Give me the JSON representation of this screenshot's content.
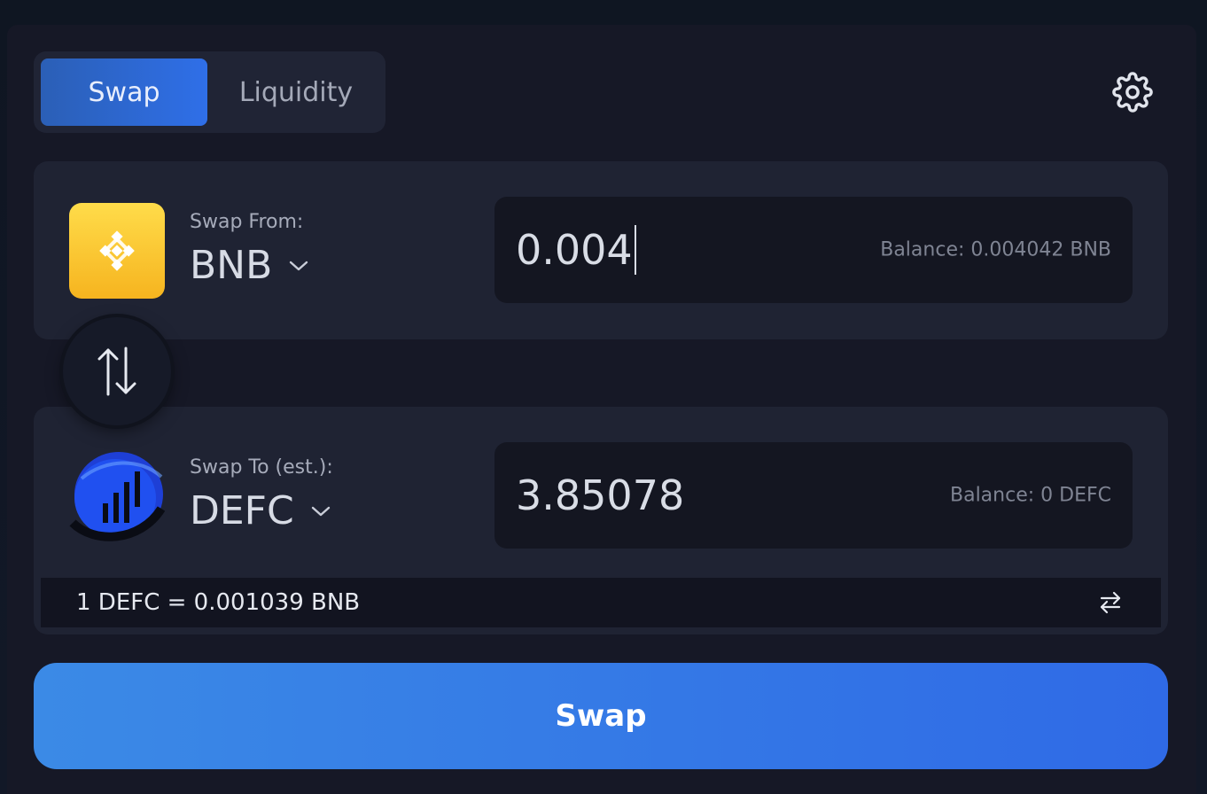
{
  "tabs": {
    "swap_label": "Swap",
    "liquidity_label": "Liquidity",
    "active": "Swap"
  },
  "settings": {
    "icon": "gear-icon"
  },
  "from": {
    "caption": "Swap From:",
    "token": "BNB",
    "token_icon": "bnb-logo-icon",
    "amount": "0.004",
    "balance": "Balance: 0.004042 BNB"
  },
  "switch": {
    "icon": "swap-vertical-arrows-icon"
  },
  "to": {
    "caption": "Swap To (est.):",
    "token": "DEFC",
    "token_icon": "defc-logo-icon",
    "amount": "3.85078",
    "balance": "Balance: 0 DEFC"
  },
  "rate": {
    "text": "1 DEFC = 0.001039 BNB",
    "toggle_icon": "swap-horizontal-arrows-icon"
  },
  "action": {
    "swap_label": "Swap"
  },
  "colors": {
    "accent": "#2f6fe8",
    "bnb_yellow": "#f6b41f",
    "background": "#161826",
    "panel": "#1f2333"
  }
}
